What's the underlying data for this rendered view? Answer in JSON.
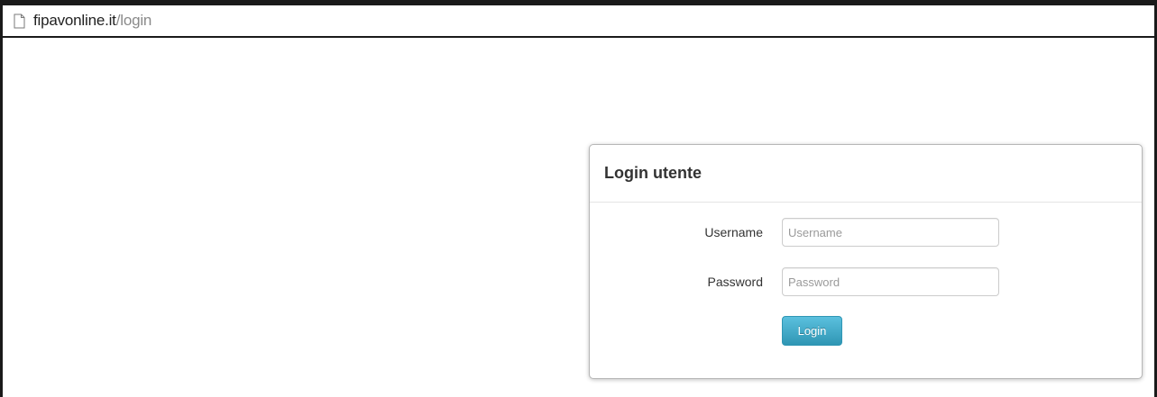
{
  "browser": {
    "url_domain": "fipavonline.it",
    "url_path": "/login",
    "page_icon": "page-icon"
  },
  "login_panel": {
    "title": "Login utente",
    "username_label": "Username",
    "username_placeholder": "Username",
    "username_value": "",
    "password_label": "Password",
    "password_placeholder": "Password",
    "password_value": "",
    "submit_label": "Login"
  },
  "colors": {
    "button_top": "#5bc0de",
    "button_bottom": "#2f96b4",
    "frame_border": "#1a1a1a"
  }
}
